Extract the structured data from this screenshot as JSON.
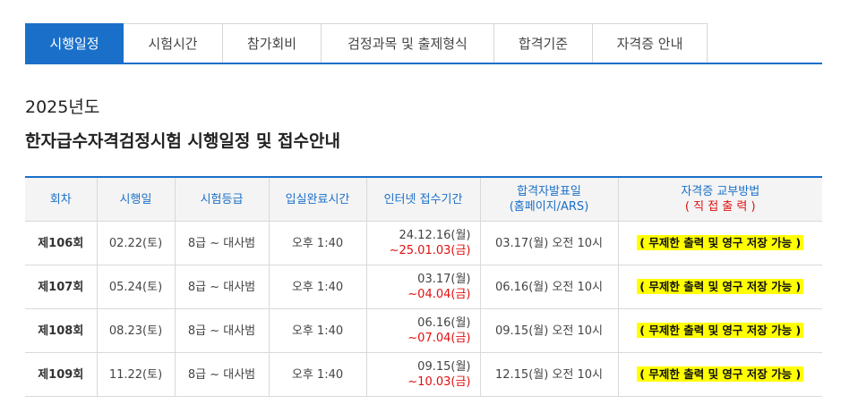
{
  "tabs": [
    {
      "label": "시행일정",
      "active": true
    },
    {
      "label": "시험시간",
      "active": false
    },
    {
      "label": "참가회비",
      "active": false
    },
    {
      "label": "검정과목 및 출제형식",
      "active": false
    },
    {
      "label": "합격기준",
      "active": false
    },
    {
      "label": "자격증 안내",
      "active": false
    }
  ],
  "heading": {
    "year": "2025년도",
    "title": "한자급수자격검정시험 시행일정 및 접수안내"
  },
  "table": {
    "headers": {
      "round": "회차",
      "exam_date": "시행일",
      "grade": "시험등급",
      "entry_time": "입실완료시간",
      "reg_period": "인터넷 접수기간",
      "result_line1": "합격자발표일",
      "result_line2": "(홈페이지/ARS)",
      "cert_line1": "자격증 교부방법",
      "cert_line2": "( 직 접 출 력 )"
    },
    "rows": [
      {
        "round": "제106회",
        "exam_date": "02.22(토)",
        "grade": "8급 ~ 대사범",
        "entry_time": "오후 1:40",
        "reg_start": "24.12.16(월)",
        "reg_end": "~25.01.03(금)",
        "result": "03.17(월) 오전 10시",
        "cert": "( 무제한 출력 및 영구 저장 가능 )"
      },
      {
        "round": "제107회",
        "exam_date": "05.24(토)",
        "grade": "8급 ~ 대사범",
        "entry_time": "오후 1:40",
        "reg_start": "03.17(월)",
        "reg_end": "~04.04(금)",
        "result": "06.16(월) 오전 10시",
        "cert": "( 무제한 출력 및 영구 저장 가능 )"
      },
      {
        "round": "제108회",
        "exam_date": "08.23(토)",
        "grade": "8급 ~ 대사범",
        "entry_time": "오후 1:40",
        "reg_start": "06.16(월)",
        "reg_end": "~07.04(금)",
        "result": "09.15(월) 오전 10시",
        "cert": "( 무제한 출력 및 영구 저장 가능 )"
      },
      {
        "round": "제109회",
        "exam_date": "11.22(토)",
        "grade": "8급 ~ 대사범",
        "entry_time": "오후 1:40",
        "reg_start": "09.15(월)",
        "reg_end": "~10.03(금)",
        "result": "12.15(월) 오전 10시",
        "cert": "( 무제한 출력 및 영구 저장 가능 )"
      }
    ]
  },
  "colors": {
    "accent": "#1a6fc9",
    "deadline": "#e01010",
    "highlight": "#ffff00"
  }
}
